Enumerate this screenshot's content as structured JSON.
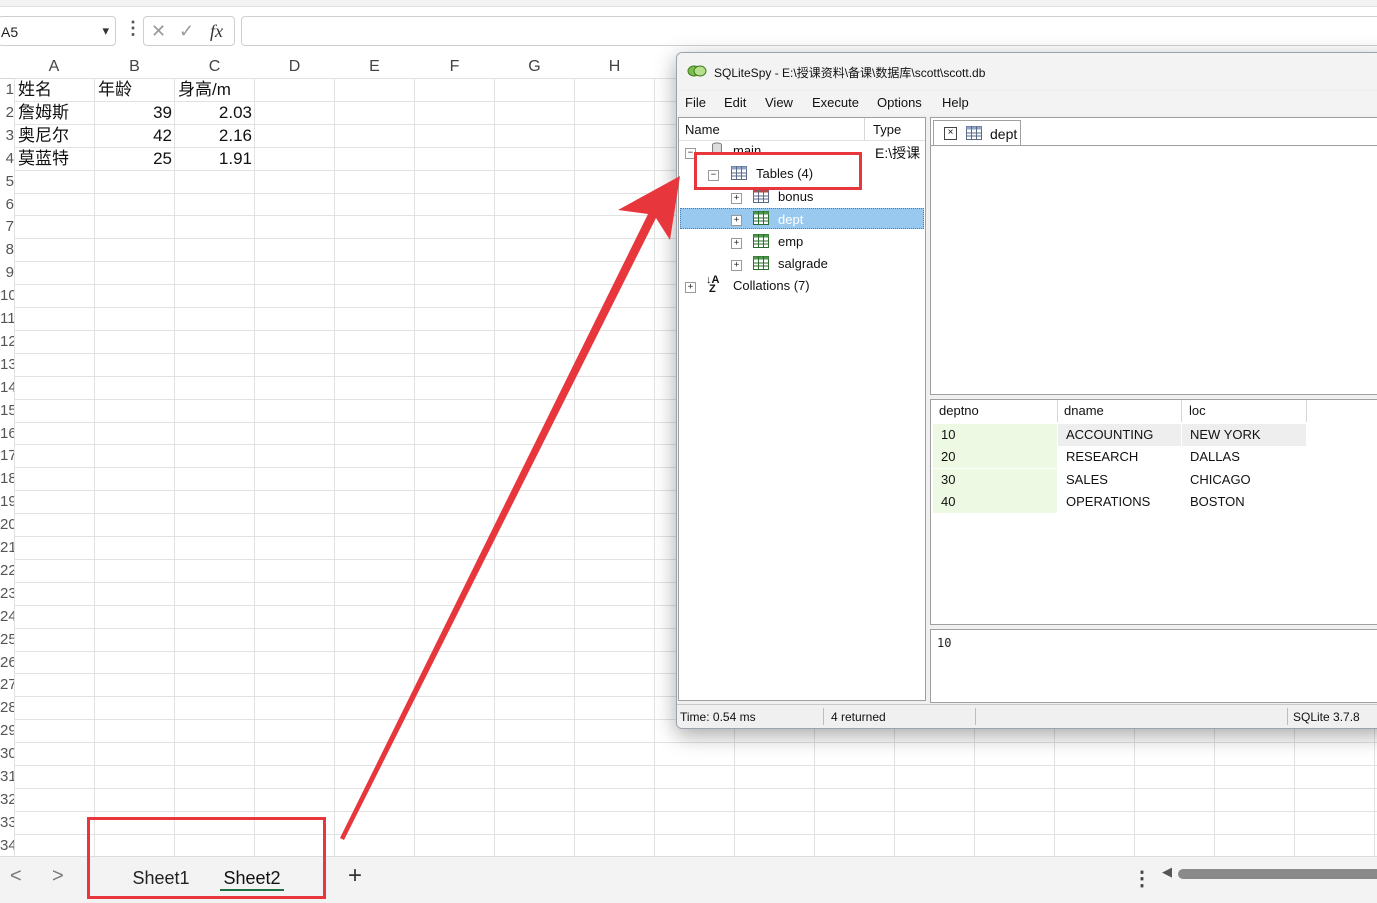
{
  "excel": {
    "name_box": "A5",
    "col_headers": [
      "A",
      "B",
      "C",
      "D",
      "E",
      "F",
      "G",
      "H"
    ],
    "row_labels": [
      "1",
      "2",
      "3",
      "4",
      "5",
      "6",
      "7",
      "8",
      "9",
      "10",
      "11",
      "12",
      "13",
      "14",
      "15",
      "16",
      "17",
      "18",
      "19",
      "20",
      "21",
      "22",
      "23",
      "24",
      "25",
      "26",
      "27",
      "28",
      "29",
      "30",
      "31",
      "32",
      "33",
      "34"
    ],
    "cells": {
      "a1": "姓名",
      "b1": "年龄",
      "c1": "身高/m",
      "a2": "詹姆斯",
      "b2": "39",
      "c2": "2.03",
      "a3": "奥尼尔",
      "b3": "42",
      "c3": "2.16",
      "a4": "莫蓝特",
      "b4": "25",
      "c4": "1.91"
    },
    "sheet_tabs": [
      "Sheet1",
      "Sheet2"
    ],
    "active_sheet": "Sheet2",
    "add_sheet": "+",
    "icons": {
      "cancel": "✕",
      "confirm": "✓",
      "fx": "fx",
      "more": "⋮",
      "prev": "<",
      "next": ">"
    }
  },
  "sqlitespy": {
    "title": "SQLiteSpy - E:\\授课资料\\备课\\数据库\\scott\\scott.db",
    "menu": [
      "File",
      "Edit",
      "View",
      "Execute",
      "Options",
      "Help"
    ],
    "tree_headers": {
      "name": "Name",
      "type": "Type"
    },
    "tree": {
      "main": "main",
      "main_type": "E:\\授课",
      "tables": "Tables (4)",
      "table_items": [
        "bonus",
        "dept",
        "emp",
        "salgrade"
      ],
      "selected": "dept",
      "collations": "Collations (7)"
    },
    "editor_tab": "dept",
    "result": {
      "columns": [
        "deptno",
        "dname",
        "loc"
      ],
      "rows": [
        [
          "10",
          "ACCOUNTING",
          "NEW YORK"
        ],
        [
          "20",
          "RESEARCH",
          "DALLAS"
        ],
        [
          "30",
          "SALES",
          "CHICAGO"
        ],
        [
          "40",
          "OPERATIONS",
          "BOSTON"
        ]
      ]
    },
    "value_view": "10",
    "status": {
      "time": "Time: 0.54 ms",
      "returned": "4 returned",
      "version": "SQLite 3.7.8"
    }
  },
  "colors": {
    "annotation_red": "#e8373c",
    "selection": "#99c9ef",
    "key_column": "#eef9e4",
    "excel_green": "#1e7145"
  }
}
